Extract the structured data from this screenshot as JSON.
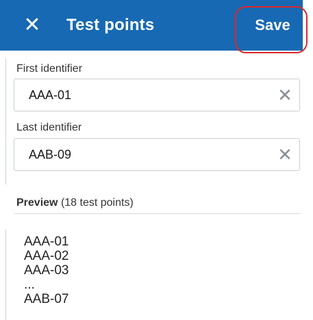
{
  "header": {
    "close_icon": "✕",
    "title": "Test points",
    "save_label": "Save",
    "accent_color": "#1769b3",
    "annotation_color": "#e0282a"
  },
  "fields": {
    "first": {
      "label": "First identifier",
      "value": "AAA-01",
      "clear_icon": "✕"
    },
    "last": {
      "label": "Last identifier",
      "value": "AAB-09",
      "clear_icon": "✕"
    }
  },
  "preview": {
    "title": "Preview",
    "count_text": "(18 test points)",
    "items": [
      "AAA-01",
      "AAA-02",
      "AAA-03",
      "...",
      "AAB-07"
    ]
  }
}
